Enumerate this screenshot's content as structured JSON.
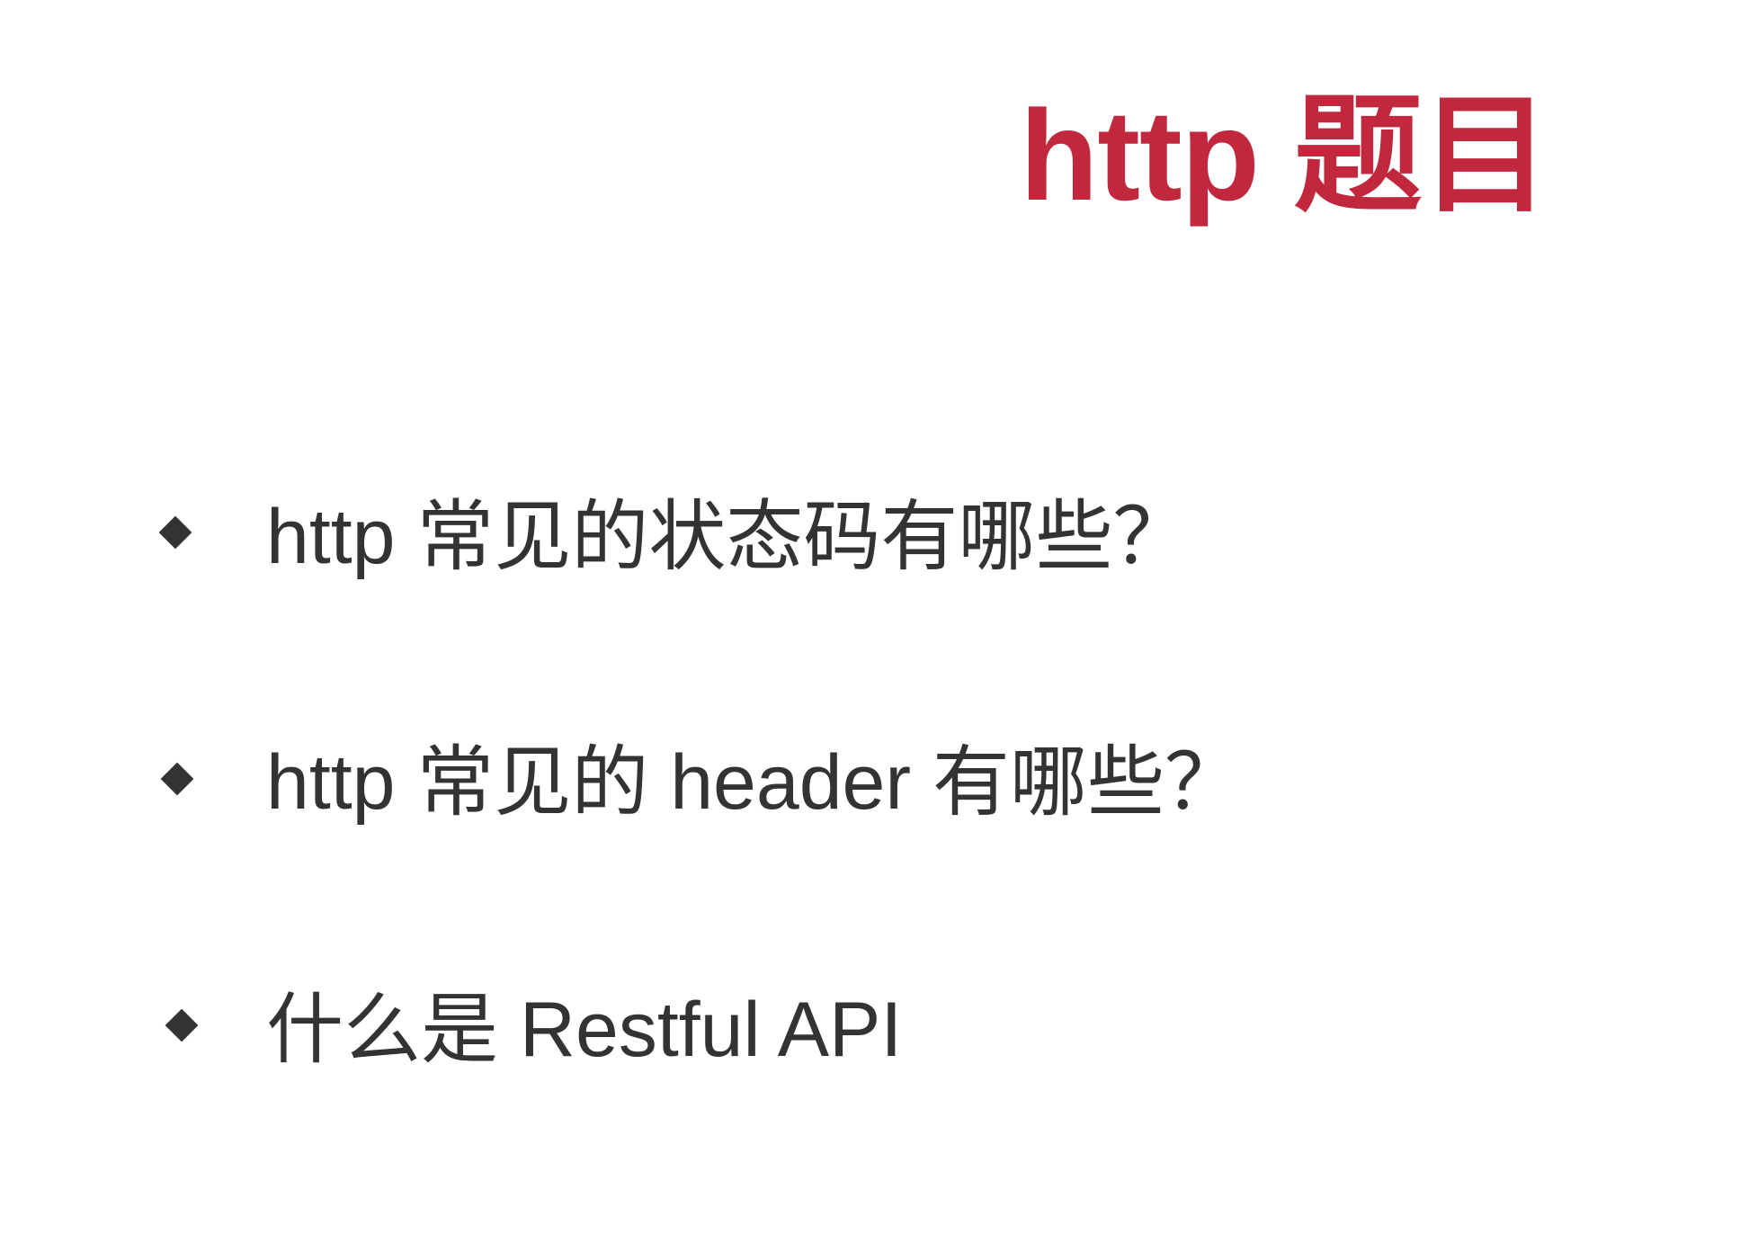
{
  "slide": {
    "title": "http 题目",
    "title_color": "#c1273d",
    "text_color": "#333333",
    "bullets": [
      {
        "icon": "diamond-bullet-icon",
        "text": "http 常见的状态码有哪些？"
      },
      {
        "icon": "diamond-bullet-icon",
        "text": "http 常见的 header 有哪些？"
      },
      {
        "icon": "diamond-bullet-icon",
        "text": "什么是 Restful API"
      }
    ]
  }
}
